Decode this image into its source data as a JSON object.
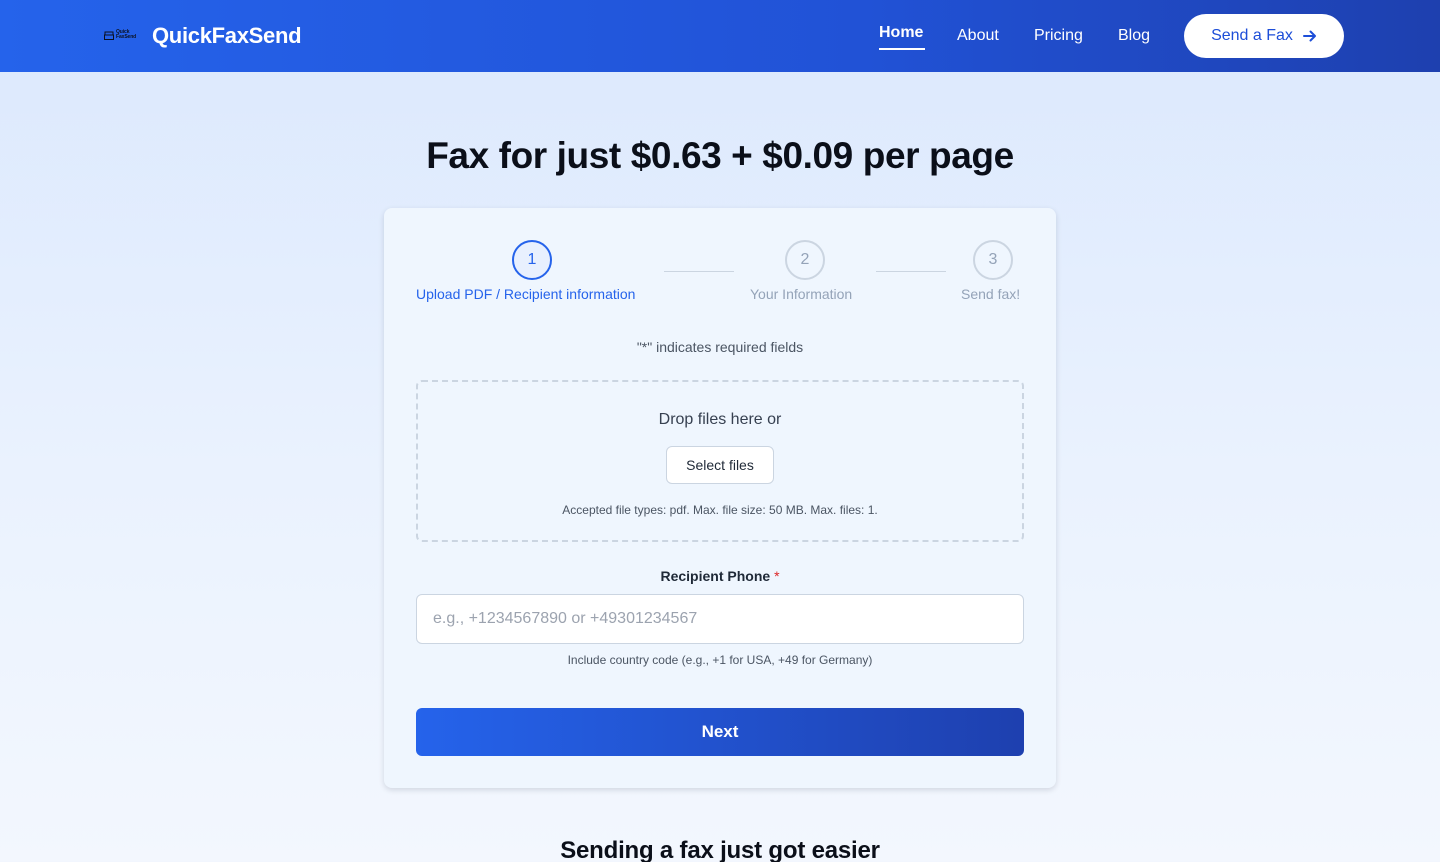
{
  "header": {
    "logo_text_line1": "Quick",
    "logo_text_line2": "FaxSend",
    "brand": "QuickFaxSend",
    "nav": [
      {
        "label": "Home",
        "active": true
      },
      {
        "label": "About",
        "active": false
      },
      {
        "label": "Pricing",
        "active": false
      },
      {
        "label": "Blog",
        "active": false
      }
    ],
    "cta_label": "Send a Fax",
    "cta_icon": "arrow-right-icon"
  },
  "hero": {
    "title": "Fax for just $0.63 + $0.09 per page"
  },
  "form": {
    "steps": [
      {
        "number": "1",
        "label": "Upload PDF / Recipient information",
        "active": true
      },
      {
        "number": "2",
        "label": "Your Information",
        "active": false
      },
      {
        "number": "3",
        "label": "Send fax!",
        "active": false
      }
    ],
    "required_note": "\"*\" indicates required fields",
    "upload": {
      "drop_text": "Drop files here or",
      "select_label": "Select files",
      "accepted_note": "Accepted file types: pdf. Max. file size: 50 MB. Max. files: 1."
    },
    "recipient": {
      "label": "Recipient Phone",
      "required_mark": "*",
      "value": "",
      "placeholder": "e.g., +1234567890 or +49301234567",
      "hint": "Include country code (e.g., +1 for USA, +49 for Germany)"
    },
    "next_label": "Next"
  },
  "section": {
    "title": "Sending a fax just got easier"
  },
  "colors": {
    "brand_blue": "#2563eb",
    "brand_blue_dark": "#1e40af",
    "required_red": "#dc2626"
  }
}
